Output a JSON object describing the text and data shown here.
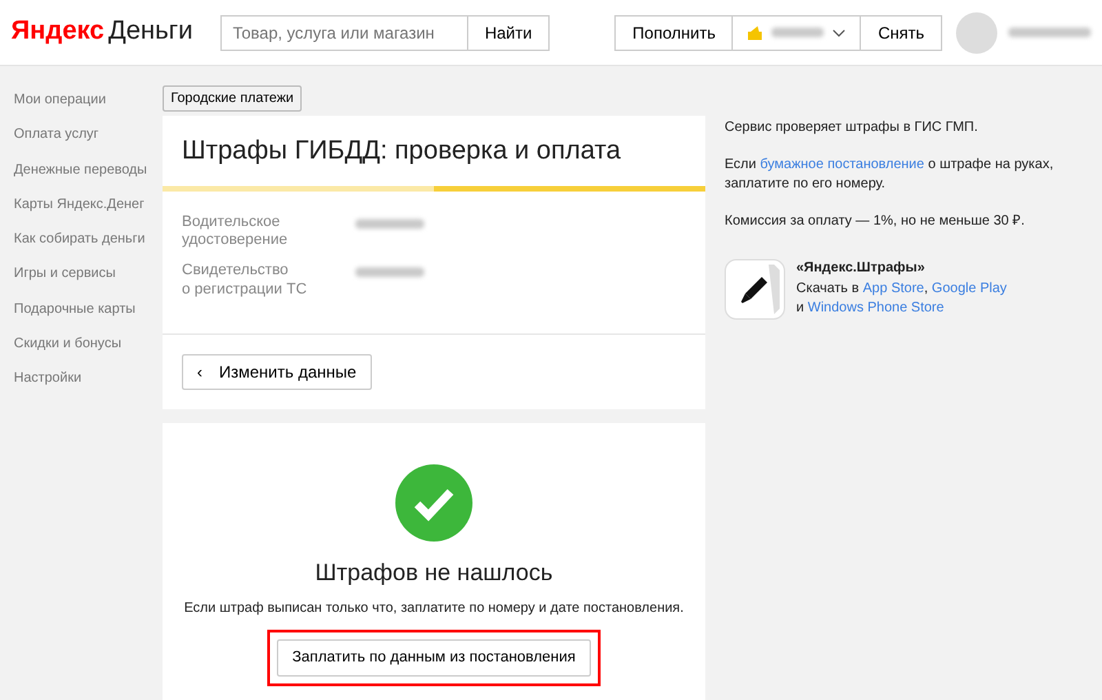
{
  "header": {
    "logo_brand": "Яндекс",
    "logo_product": "Деньги",
    "search": {
      "placeholder": "Товар, услуга или магазин",
      "button": "Найти"
    },
    "actions": [
      {
        "kind": "button",
        "label": "Пополнить"
      },
      {
        "kind": "wallet"
      },
      {
        "kind": "button",
        "label": "Снять"
      }
    ]
  },
  "sidebar": {
    "items": [
      {
        "label": "Мои операции"
      },
      {
        "label": "Оплата услуг"
      },
      {
        "label": "Денежные переводы"
      },
      {
        "label": "Карты Яндекс.Денег"
      },
      {
        "label": "Как собирать деньги"
      },
      {
        "label": "Игры и сервисы"
      },
      {
        "label": "Подарочные карты"
      },
      {
        "label": "Скидки и бонусы"
      },
      {
        "label": "Настройки"
      }
    ]
  },
  "breadcrumb": "Городские платежи",
  "form_card": {
    "title": "Штрафы ГИБДД: проверка и оплата",
    "steps": [
      {
        "current": false
      },
      {
        "current": true
      }
    ],
    "fields": [
      {
        "label": "Водительское\nудостоверение"
      },
      {
        "label": "Свидетельство\nо регистрации ТС"
      }
    ],
    "back_button": "Изменить данные",
    "back_glyph": "‹"
  },
  "result_card": {
    "title": "Штрафов не нашлось",
    "text": "Если штраф выписан только что, заплатите по номеру и дате постановления.",
    "button": {
      "label": "Заплатить по данным из постановления",
      "highlighted": true
    }
  },
  "info": {
    "paragraphs": [
      "Сервис проверяет штрафы в ГИС ГМП.",
      [
        {
          "text": "Если "
        },
        {
          "text": "бумажное постановление",
          "link": true
        },
        {
          "text": " о штрафе на руках, заплатите по его номеру."
        }
      ],
      "Комиссия за оплату — 1%, но не меньше 30 ₽."
    ],
    "app": {
      "name": "«Яндекс.Штрафы»",
      "line1": [
        {
          "text": "Скачать в "
        },
        {
          "text": "App Store",
          "link": true
        },
        {
          "text": ", "
        },
        {
          "text": "Google Play",
          "link": true
        }
      ],
      "line2": [
        {
          "text": "и "
        },
        {
          "text": "Windows Phone Store",
          "link": true
        }
      ]
    }
  }
}
